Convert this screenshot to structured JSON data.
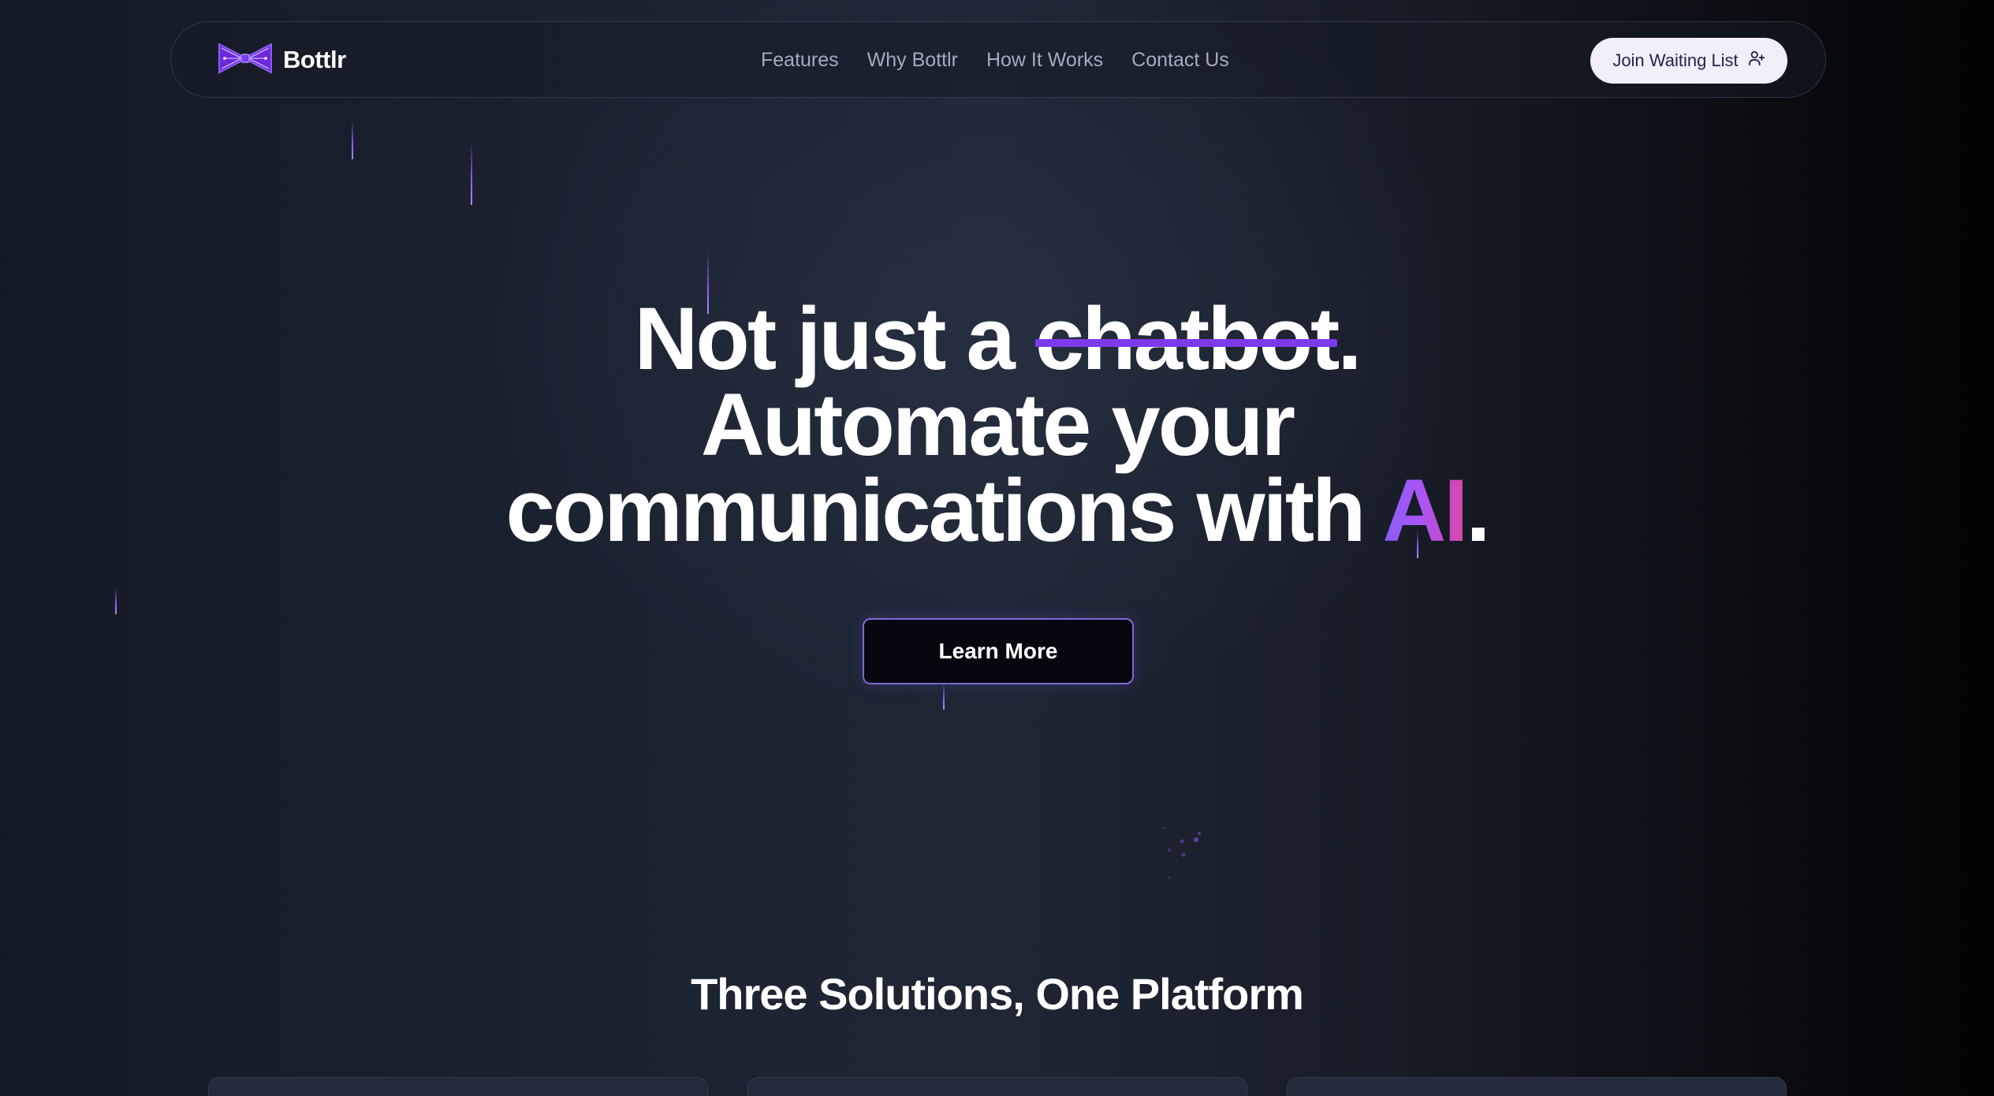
{
  "brand": {
    "name": "Bottlr",
    "logo_icon": "bowtie-logo-icon",
    "accent": "#7c3aed"
  },
  "nav": {
    "links": [
      "Features",
      "Why Bottlr",
      "How It Works",
      "Contact Us"
    ],
    "cta_label": "Join Waiting List",
    "cta_icon": "user-plus-icon"
  },
  "hero": {
    "line1_prefix": "Not just a ",
    "line1_struck": "chatbot",
    "line1_suffix": ".",
    "line2": "Automate your",
    "line3_prefix": "communications with ",
    "line3_highlight": "AI",
    "line3_suffix": ".",
    "button_label": "Learn More"
  },
  "solutions": {
    "title": "Three Solutions, One Platform"
  },
  "colors": {
    "strike": "#7c3aed",
    "ai_gradient_start": "#8b5cf6",
    "ai_gradient_end": "#d946a8",
    "cta_background": "#f1eff9"
  }
}
